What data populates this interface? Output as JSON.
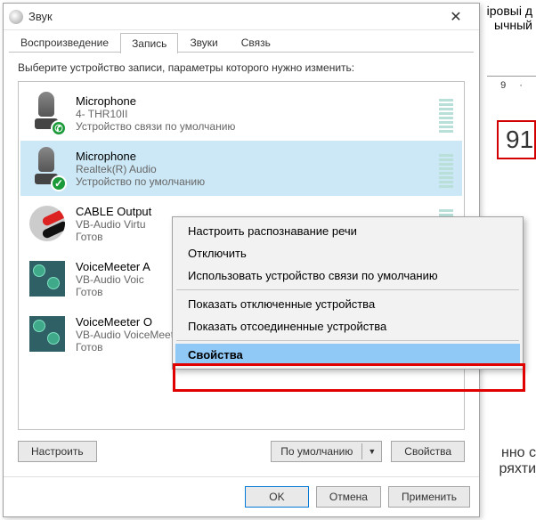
{
  "bg": {
    "top_fragment1": "іровыі д",
    "top_fragment2": "ычный",
    "scale1": "9",
    "scale2": "·",
    "big_number": "91",
    "bottom_fragment1": "нно с",
    "bottom_fragment2": "ряхти"
  },
  "dialog": {
    "title": "Звук"
  },
  "tabs": {
    "play": "Воспроизведение",
    "record": "Запись",
    "sounds": "Звуки",
    "comm": "Связь"
  },
  "instruction": "Выберите устройство записи, параметры которого нужно изменить:",
  "devices": [
    {
      "name": "Microphone",
      "desc": "4- THR10II",
      "status": "Устройство связи по умолчанию"
    },
    {
      "name": "Microphone",
      "desc": "Realtek(R) Audio",
      "status": "Устройство по умолчанию"
    },
    {
      "name": "CABLE Output",
      "desc": "VB-Audio Virtu",
      "status": "Готов"
    },
    {
      "name": "VoiceMeeter A",
      "desc": "VB-Audio Voic",
      "status": "Готов"
    },
    {
      "name": "VoiceMeeter O",
      "desc": "VB-Audio VoiceMeeter VAIO",
      "status": "Готов"
    }
  ],
  "context_menu": {
    "configure_speech": "Настроить распознавание речи",
    "disable": "Отключить",
    "use_default_comm": "Использовать устройство связи по умолчанию",
    "show_disabled": "Показать отключенные устройства",
    "show_disconnected": "Показать отсоединенные устройства",
    "properties": "Свойства"
  },
  "panel_buttons": {
    "configure": "Настроить",
    "default": "По умолчанию",
    "properties": "Свойства"
  },
  "footer": {
    "ok": "OK",
    "cancel": "Отмена",
    "apply": "Применить"
  }
}
